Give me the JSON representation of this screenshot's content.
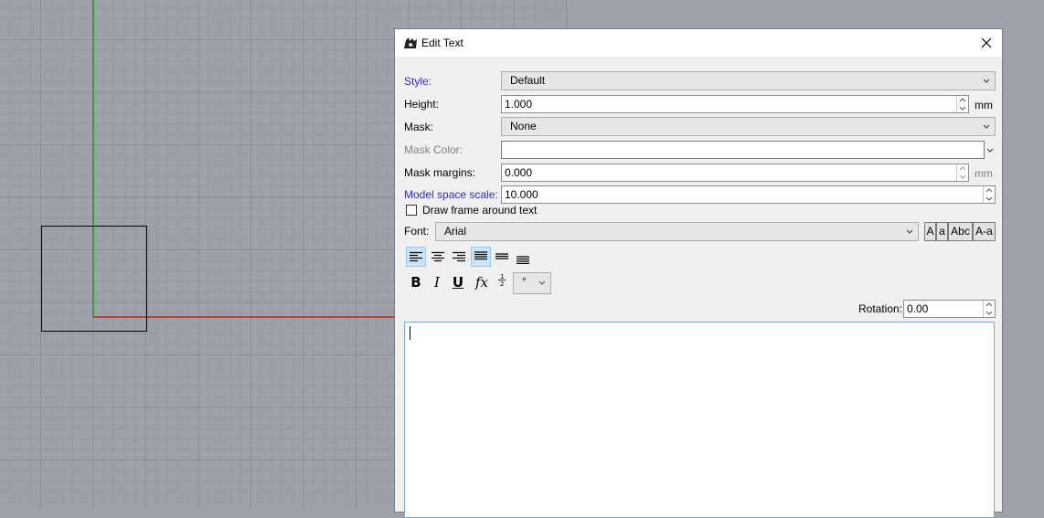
{
  "dialog": {
    "title": "Edit Text",
    "fields": {
      "style_label": "Style:",
      "style_value": "Default",
      "height_label": "Height:",
      "height_value": "1.000",
      "height_unit": "mm",
      "mask_label": "Mask:",
      "mask_value": "None",
      "mask_color_label": "Mask Color:",
      "mask_margins_label": "Mask margins:",
      "mask_margins_value": "0.000",
      "mask_margins_unit": "mm",
      "model_space_scale_label": "Model space scale:",
      "model_space_scale_value": "10.000",
      "draw_frame_label": "Draw frame around text",
      "font_label": "Font:",
      "font_value": "Arial",
      "rotation_label": "Rotation:",
      "rotation_value": "0.00"
    },
    "case_buttons": [
      "A",
      "a",
      "Abc",
      "A-a"
    ],
    "format_buttons": {
      "bold": "B",
      "italic": "I",
      "underline": "U",
      "fx": "fx",
      "symbol_value": "°"
    },
    "alignment": {
      "horizontal_selected": "left",
      "vertical_selected": "top"
    },
    "text_content": ""
  },
  "colors": {
    "accent_label": "#2a2adf",
    "selected_button": "#cce4f7",
    "y_axis": "#3c9b3c",
    "x_axis": "#b8433a"
  }
}
